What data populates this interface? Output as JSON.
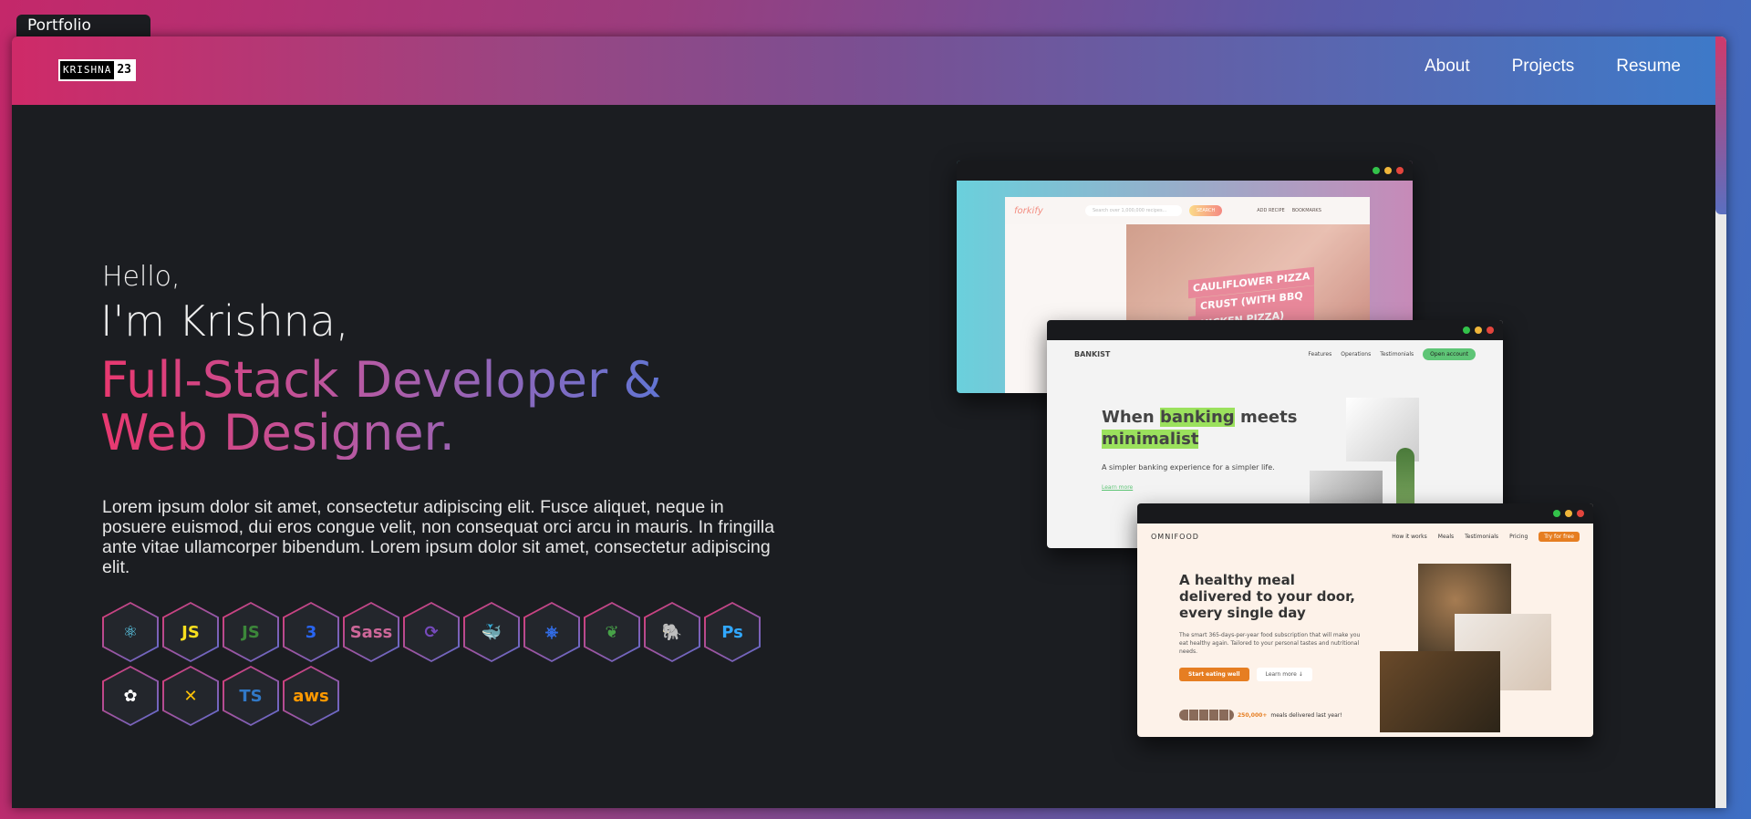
{
  "tab": {
    "title": "Portfolio"
  },
  "nav": {
    "logo_left": "KRISHNA",
    "logo_right": "23",
    "links": [
      "About",
      "Projects",
      "Resume"
    ]
  },
  "hero": {
    "greeting": "Hello,",
    "name": "I'm Krishna,",
    "role": "Full-Stack Developer & Web Designer.",
    "description": "Lorem ipsum dolor sit amet, consectetur adipiscing elit. Fusce aliquet, neque in posuere euismod, dui eros congue velit, non consequat orci arcu in mauris. In fringilla ante vitae ullamcorper bibendum. Lorem ipsum dolor sit amet, consectetur adipiscing elit."
  },
  "skills": [
    {
      "icon": "react-icon",
      "glyph": "⚛",
      "color": "#61dafb"
    },
    {
      "icon": "javascript-icon",
      "glyph": "JS",
      "color": "#f7df1e"
    },
    {
      "icon": "nodejs-icon",
      "glyph": "JS",
      "color": "#3c873a"
    },
    {
      "icon": "css3-icon",
      "glyph": "3",
      "color": "#2965f1"
    },
    {
      "icon": "sass-icon",
      "glyph": "Sass",
      "color": "#cd6799"
    },
    {
      "icon": "redux-icon",
      "glyph": "⟳",
      "color": "#764abc"
    },
    {
      "icon": "docker-icon",
      "glyph": "🐳",
      "color": "#2496ed"
    },
    {
      "icon": "kubernetes-icon",
      "glyph": "⎈",
      "color": "#326ce5"
    },
    {
      "icon": "mongodb-icon",
      "glyph": "❦",
      "color": "#47a248"
    },
    {
      "icon": "postgresql-icon",
      "glyph": "🐘",
      "color": "#336791"
    },
    {
      "icon": "photoshop-icon",
      "glyph": "Ps",
      "color": "#31a8ff"
    },
    {
      "icon": "figma-icon",
      "glyph": "✿",
      "color": "#ffffff"
    },
    {
      "icon": "xd-icon",
      "glyph": "✕",
      "color": "#ffc107"
    },
    {
      "icon": "typescript-icon",
      "glyph": "TS",
      "color": "#3178c6"
    },
    {
      "icon": "aws-icon",
      "glyph": "aws",
      "color": "#ff9900"
    }
  ],
  "projects": {
    "forkify": {
      "brand": "forkify",
      "search_placeholder": "Search over 1,000,000 recipes...",
      "search_button": "SEARCH",
      "add_recipe": "ADD RECIPE",
      "bookmarks": "BOOKMARKS",
      "hero_lines": [
        "CAULIFLOWER PIZZA",
        "CRUST (WITH BBQ",
        "CHICKEN PIZZA)"
      ]
    },
    "bankist": {
      "brand": "BANKIST",
      "links": [
        "Features",
        "Operations",
        "Testimonials"
      ],
      "cta": "Open account",
      "headline_1": "When",
      "headline_hl_1": "banking",
      "headline_2": "meets",
      "headline_hl_2": "minimalist",
      "subtitle": "A simpler banking experience for a simpler life.",
      "learn_more": "Learn more"
    },
    "omnifood": {
      "brand": "OMNIFOOD",
      "links": [
        "How it works",
        "Meals",
        "Testimonials",
        "Pricing"
      ],
      "cta": "Try for free",
      "headline": "A healthy meal delivered to your door, every single day",
      "description": "The smart 365-days-per-year food subscription that will make you eat healthy again. Tailored to your personal tastes and nutritional needs.",
      "btn_primary": "Start eating well",
      "btn_secondary": "Learn more ↓",
      "stat": "250,000+",
      "stat_text": "meals delivered last year!"
    }
  }
}
